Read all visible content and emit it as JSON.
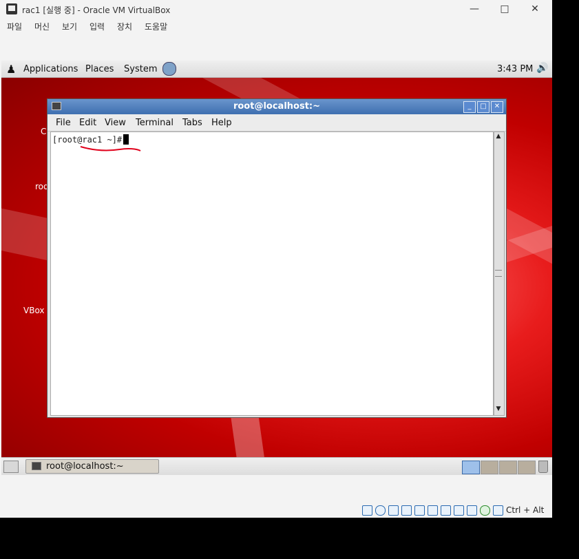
{
  "vbox": {
    "title": "rac1 [실행 중] - Oracle VM VirtualBox",
    "menu": [
      "파일",
      "머신",
      "보기",
      "입력",
      "장치",
      "도움말"
    ],
    "host_key": "Ctrl + Alt"
  },
  "gnome_top": {
    "applications": "Applications",
    "places": "Places",
    "system": "System",
    "clock": "3:43 PM"
  },
  "desktop_icons": {
    "c_label": "C",
    "roo_label": "roo",
    "vbox_label": "VBox"
  },
  "terminal": {
    "title": "root@localhost:~",
    "menu": {
      "file": "File",
      "edit": "Edit",
      "view": "View",
      "terminal": "Terminal",
      "tabs": "Tabs",
      "help": "Help"
    },
    "prompt": "[root@rac1 ~]#"
  },
  "taskbar": {
    "task_label": "root@localhost:~"
  },
  "colors": {
    "desktop_red": "#d40000",
    "titlebar_blue": "#3e6fb0",
    "annotation_red": "#e0001b"
  }
}
